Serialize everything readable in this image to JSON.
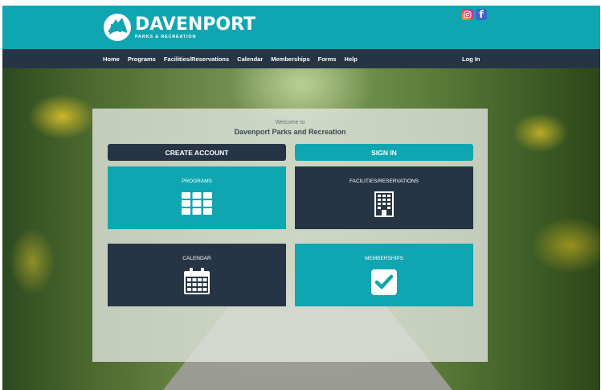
{
  "header": {
    "logo_title": "DAVENPORT",
    "logo_subtitle": "PARKS & RECREATION",
    "facebook_glyph": "f"
  },
  "nav": {
    "items": [
      {
        "label": "Home"
      },
      {
        "label": "Programs"
      },
      {
        "label": "Facilities/Reservations"
      },
      {
        "label": "Calendar"
      },
      {
        "label": "Memberships"
      },
      {
        "label": "Forms"
      },
      {
        "label": "Help"
      }
    ],
    "login_label": "Log In"
  },
  "panel": {
    "welcome": "Welcome to",
    "site_name": "Davenport Parks and Recreation",
    "create_account": "CREATE ACCOUNT",
    "sign_in": "SIGN IN",
    "tiles": {
      "programs": {
        "label": "PROGRAMS",
        "icon": "grid-icon"
      },
      "facilities": {
        "label": "FACILITIES/RESERVATIONS",
        "icon": "building-icon"
      },
      "calendar": {
        "label": "CALENDAR",
        "icon": "calendar-icon"
      },
      "memberships": {
        "label": "MEMBERSHIPS",
        "icon": "checkbox-icon"
      }
    }
  },
  "colors": {
    "teal": "#0fa6b2",
    "navy": "#263545"
  }
}
